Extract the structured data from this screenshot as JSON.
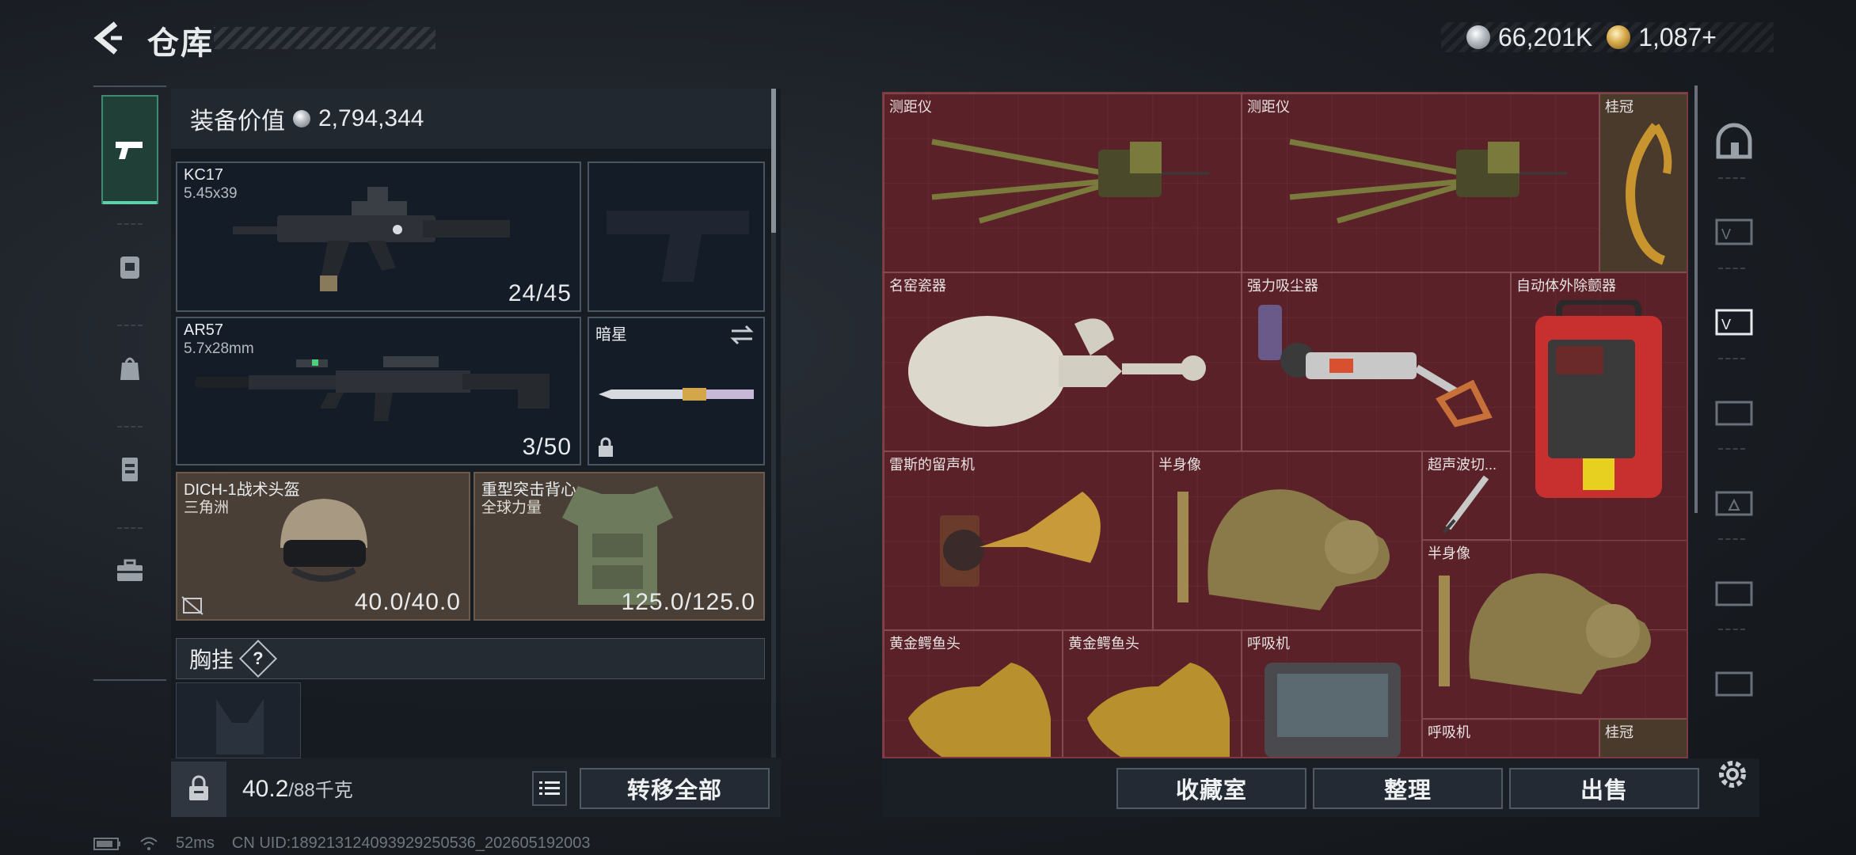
{
  "header": {
    "title": "仓库",
    "currency": [
      {
        "icon": "silver-coin-icon",
        "value": "66,201K"
      },
      {
        "icon": "gold-coin-icon",
        "value": "1,087+"
      }
    ]
  },
  "left_nav": {
    "items": [
      {
        "name": "weapons",
        "icon": "pistol-icon",
        "active": true
      },
      {
        "name": "gear",
        "icon": "backpack-icon"
      },
      {
        "name": "bag",
        "icon": "bag-icon"
      },
      {
        "name": "rig",
        "icon": "vest-icon"
      },
      {
        "name": "toolbox",
        "icon": "toolbox-icon"
      }
    ]
  },
  "equipment": {
    "value_label": "装备价值",
    "value": "2,794,344",
    "primary1": {
      "name": "KC17",
      "caliber": "5.45x39",
      "ammo": "24/45"
    },
    "primary2": {
      "name": "AR57",
      "caliber": "5.7x28mm",
      "ammo": "3/50"
    },
    "melee": {
      "name": "暗星"
    },
    "helmet": {
      "name": "DICH-1战术头盔",
      "faction": "三角洲",
      "durability": "40.0/40.0"
    },
    "armor": {
      "name": "重型突击背心",
      "faction": "全球力量",
      "durability": "125.0/125.0"
    },
    "chest_label": "胸挂",
    "chest_help": "?"
  },
  "bottom_left": {
    "weight": "40.2",
    "weight_max": "/88千克",
    "transfer_all": "转移全部"
  },
  "grid_items": [
    {
      "label": "测距仪"
    },
    {
      "label": "测距仪"
    },
    {
      "label": "桂冠"
    },
    {
      "label": "名窑瓷器"
    },
    {
      "label": "强力吸尘器"
    },
    {
      "label": "自动体外除颤器"
    },
    {
      "label": "雷斯的留声机"
    },
    {
      "label": "半身像"
    },
    {
      "label": "超声波切..."
    },
    {
      "label": "半身像"
    },
    {
      "label": "黄金鳄鱼头"
    },
    {
      "label": "黄金鳄鱼头"
    },
    {
      "label": "呼吸机"
    },
    {
      "label": "呼吸机"
    },
    {
      "label": "桂冠"
    }
  ],
  "bottom_right": {
    "collection": "收藏室",
    "organize": "整理",
    "sell": "出售"
  },
  "status_bar": {
    "ping": "52ms",
    "uid": "CN UID:18921312409392925053​6_202605192003"
  }
}
